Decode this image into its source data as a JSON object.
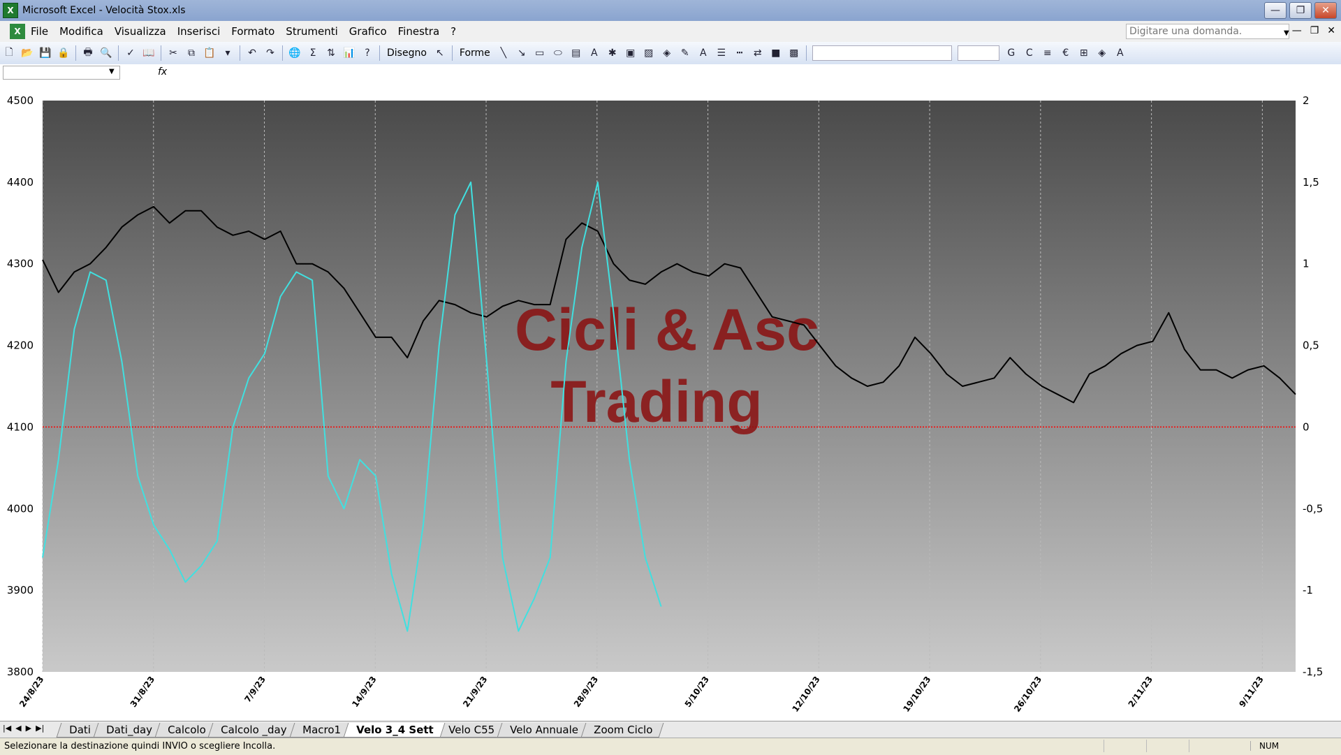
{
  "window": {
    "title": "Microsoft Excel - Velocità Stox.xls"
  },
  "menu": {
    "items": [
      "File",
      "Modifica",
      "Visualizza",
      "Inserisci",
      "Formato",
      "Strumenti",
      "Grafico",
      "Finestra",
      "?"
    ],
    "ask_placeholder": "Digitare una domanda."
  },
  "toolbar": {
    "disegno_label": "Disegno",
    "forme_label": "Forme",
    "sigma": "Σ"
  },
  "formula_bar": {
    "fx": "fx"
  },
  "sheet_tabs": [
    "Dati",
    "Dati_day",
    "Calcolo",
    "Calcolo _day",
    "Macro1",
    "Velo 3_4 Sett",
    "Velo C55",
    "Velo Annuale",
    "Zoom Ciclo"
  ],
  "active_tab": "Velo 3_4 Sett",
  "status": {
    "message": "Selezionare la destinazione quindi INVIO o scegliere Incolla.",
    "num": "NUM"
  },
  "chart_data": {
    "type": "line",
    "watermark": [
      "Cicli & Asc",
      "Trading"
    ],
    "x_tick_labels": [
      "24/8/23",
      "31/8/23",
      "7/9/23",
      "14/9/23",
      "21/9/23",
      "28/9/23",
      "5/10/23",
      "12/10/23",
      "19/10/23",
      "26/10/23",
      "2/11/23",
      "9/11/23"
    ],
    "x_range": [
      0,
      79
    ],
    "y_left": {
      "range": [
        3800,
        4500
      ],
      "ticks": [
        "4500",
        "4400",
        "4300",
        "4200",
        "4100",
        "4000",
        "3900",
        "3800"
      ]
    },
    "y_right": {
      "range": [
        -1.5,
        2
      ],
      "ticks": [
        "2",
        "1,5",
        "1",
        "0,5",
        "0",
        "-0,5",
        "-1",
        "-1,5"
      ]
    },
    "zero_line": 0,
    "colors": {
      "price": "#000000",
      "cyan": "#40e0e0",
      "red": "#e02020",
      "blue": "#1010e0",
      "zero": "#ff0000"
    },
    "series": [
      {
        "axis": "left",
        "color": "#000000",
        "values": [
          [
            0,
            4305
          ],
          [
            1,
            4265
          ],
          [
            2,
            4290
          ],
          [
            3,
            4300
          ],
          [
            4,
            4320
          ],
          [
            5,
            4345
          ],
          [
            6,
            4360
          ],
          [
            7,
            4370
          ],
          [
            8,
            4350
          ],
          [
            9,
            4365
          ],
          [
            10,
            4365
          ],
          [
            11,
            4345
          ],
          [
            12,
            4335
          ],
          [
            13,
            4340
          ],
          [
            14,
            4330
          ],
          [
            15,
            4340
          ],
          [
            16,
            4300
          ],
          [
            17,
            4300
          ],
          [
            18,
            4290
          ],
          [
            19,
            4270
          ],
          [
            20,
            4240
          ],
          [
            21,
            4210
          ],
          [
            22,
            4210
          ],
          [
            23,
            4185
          ],
          [
            24,
            4230
          ],
          [
            25,
            4255
          ],
          [
            26,
            4250
          ],
          [
            27,
            4240
          ],
          [
            28,
            4235
          ],
          [
            29,
            4248
          ],
          [
            30,
            4255
          ],
          [
            31,
            4250
          ],
          [
            32,
            4250
          ],
          [
            33,
            4330
          ],
          [
            34,
            4350
          ],
          [
            35,
            4340
          ],
          [
            36,
            4300
          ],
          [
            37,
            4280
          ],
          [
            38,
            4275
          ],
          [
            39,
            4290
          ],
          [
            40,
            4300
          ],
          [
            41,
            4290
          ],
          [
            42,
            4285
          ],
          [
            43,
            4300
          ],
          [
            44,
            4295
          ],
          [
            45,
            4265
          ],
          [
            46,
            4235
          ],
          [
            47,
            4230
          ],
          [
            48,
            4225
          ],
          [
            49,
            4200
          ],
          [
            50,
            4175
          ],
          [
            51,
            4160
          ],
          [
            52,
            4150
          ],
          [
            53,
            4155
          ],
          [
            54,
            4175
          ],
          [
            55,
            4210
          ],
          [
            56,
            4190
          ],
          [
            57,
            4165
          ],
          [
            58,
            4150
          ],
          [
            59,
            4155
          ],
          [
            60,
            4160
          ],
          [
            61,
            4185
          ],
          [
            62,
            4165
          ],
          [
            63,
            4150
          ],
          [
            64,
            4140
          ],
          [
            65,
            4130
          ],
          [
            66,
            4165
          ],
          [
            67,
            4175
          ],
          [
            68,
            4190
          ],
          [
            69,
            4200
          ],
          [
            70,
            4205
          ],
          [
            71,
            4240
          ],
          [
            72,
            4195
          ],
          [
            73,
            4170
          ],
          [
            74,
            4170
          ],
          [
            75,
            4160
          ],
          [
            76,
            4170
          ],
          [
            77,
            4175
          ],
          [
            78,
            4160
          ],
          [
            79,
            4140
          ]
        ]
      },
      {
        "axis": "right",
        "color": "#40e0e0",
        "values": [
          [
            0,
            -0.8
          ],
          [
            1,
            -0.2
          ],
          [
            2,
            0.6
          ],
          [
            3,
            0.95
          ],
          [
            4,
            0.9
          ],
          [
            5,
            0.4
          ],
          [
            6,
            -0.3
          ],
          [
            7,
            -0.6
          ],
          [
            8,
            -0.75
          ],
          [
            9,
            -0.95
          ],
          [
            10,
            -0.85
          ],
          [
            11,
            -0.7
          ],
          [
            12,
            0.0
          ],
          [
            13,
            0.3
          ],
          [
            14,
            0.45
          ],
          [
            15,
            0.8
          ],
          [
            16,
            0.95
          ],
          [
            17,
            0.9
          ],
          [
            18,
            -0.3
          ],
          [
            19,
            -0.5
          ],
          [
            20,
            -0.2
          ],
          [
            21,
            -0.3
          ],
          [
            22,
            -0.9
          ],
          [
            23,
            -1.25
          ],
          [
            24,
            -0.6
          ],
          [
            25,
            0.5
          ],
          [
            26,
            1.3
          ],
          [
            27,
            1.5
          ],
          [
            28,
            0.4
          ],
          [
            29,
            -0.8
          ],
          [
            30,
            -1.25
          ],
          [
            31,
            -1.05
          ],
          [
            32,
            -0.8
          ],
          [
            33,
            0.4
          ],
          [
            34,
            1.1
          ],
          [
            35,
            1.5
          ],
          [
            36,
            0.7
          ],
          [
            37,
            -0.2
          ],
          [
            38,
            -0.8
          ],
          [
            39,
            -1.1
          ]
        ]
      }
    ]
  }
}
